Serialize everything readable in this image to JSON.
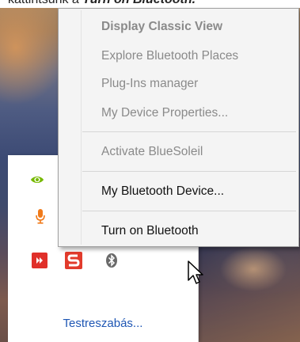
{
  "header": {
    "instruction_prefix": "kattintsunk a",
    "instruction_emphasis": "Turn on Bluetooth."
  },
  "context_menu": {
    "items": [
      {
        "label": "Display Classic View",
        "state": "disabled",
        "bold": true
      },
      {
        "label": "Explore Bluetooth Places",
        "state": "disabled"
      },
      {
        "label": "Plug-Ins manager",
        "state": "disabled"
      },
      {
        "label": "My Device Properties...",
        "state": "disabled"
      },
      {
        "label": "Activate BlueSoleil",
        "state": "disabled"
      },
      {
        "label": "My Bluetooth Device...",
        "state": "enabled"
      },
      {
        "label": "Turn on Bluetooth",
        "state": "enabled"
      }
    ]
  },
  "tray": {
    "icons": [
      "nvidia-icon",
      "microphone-icon",
      "red-arrow-icon",
      "s-app-icon",
      "bluetooth-icon"
    ],
    "customize_link": "Testreszabás..."
  },
  "colors": {
    "menu_bg": "#f4f4f4",
    "disabled_text": "#8a8a8a",
    "link": "#1e56b4",
    "nvidia_green": "#76b900",
    "mic_orange": "#f07a1a",
    "app_red": "#e0302a"
  }
}
